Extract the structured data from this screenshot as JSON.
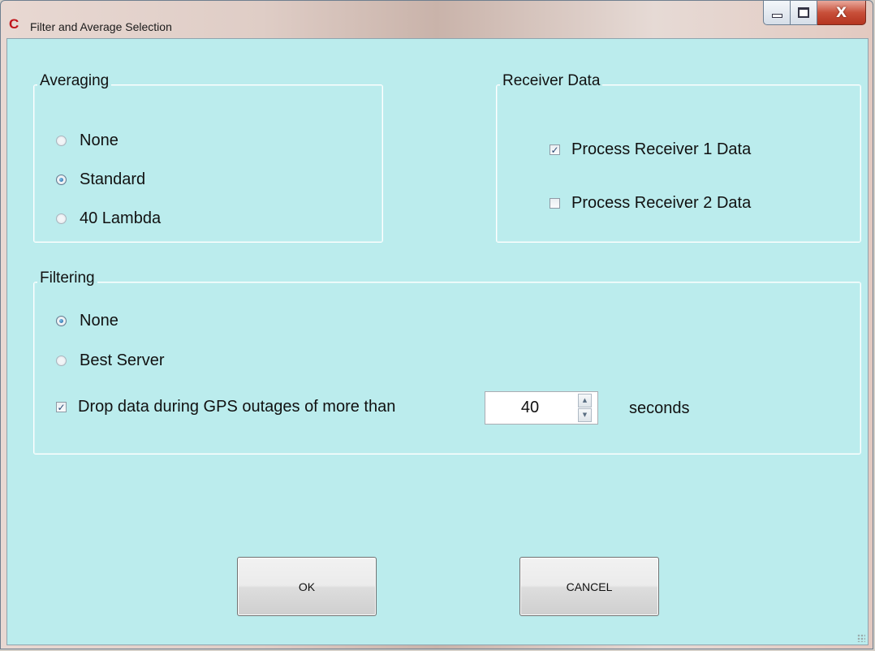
{
  "window": {
    "icon_glyph": "C",
    "title": "Filter and Average Selection",
    "minimize_glyph": "–",
    "close_glyph": "X",
    "colors": {
      "client_bg": "#bbeced",
      "close_btn": "#c8503a"
    }
  },
  "averaging": {
    "legend": "Averaging",
    "options": [
      {
        "label": "None",
        "selected": false
      },
      {
        "label": "Standard",
        "selected": true
      },
      {
        "label": "40 Lambda",
        "selected": false
      }
    ]
  },
  "receiver": {
    "legend": "Receiver Data",
    "options": [
      {
        "label": "Process Receiver 1 Data",
        "checked": true
      },
      {
        "label": "Process Receiver 2 Data",
        "checked": false
      }
    ]
  },
  "filtering": {
    "legend": "Filtering",
    "options": [
      {
        "label": "None",
        "selected": true
      },
      {
        "label": "Best Server",
        "selected": false
      }
    ],
    "drop": {
      "label": "Drop data during GPS outages of more than",
      "checked": true,
      "value": "40",
      "unit": "seconds"
    }
  },
  "buttons": {
    "ok": "OK",
    "cancel": "CANCEL"
  },
  "icons": {
    "checkmark": "✓",
    "spin_up": "▲",
    "spin_down": "▼"
  }
}
